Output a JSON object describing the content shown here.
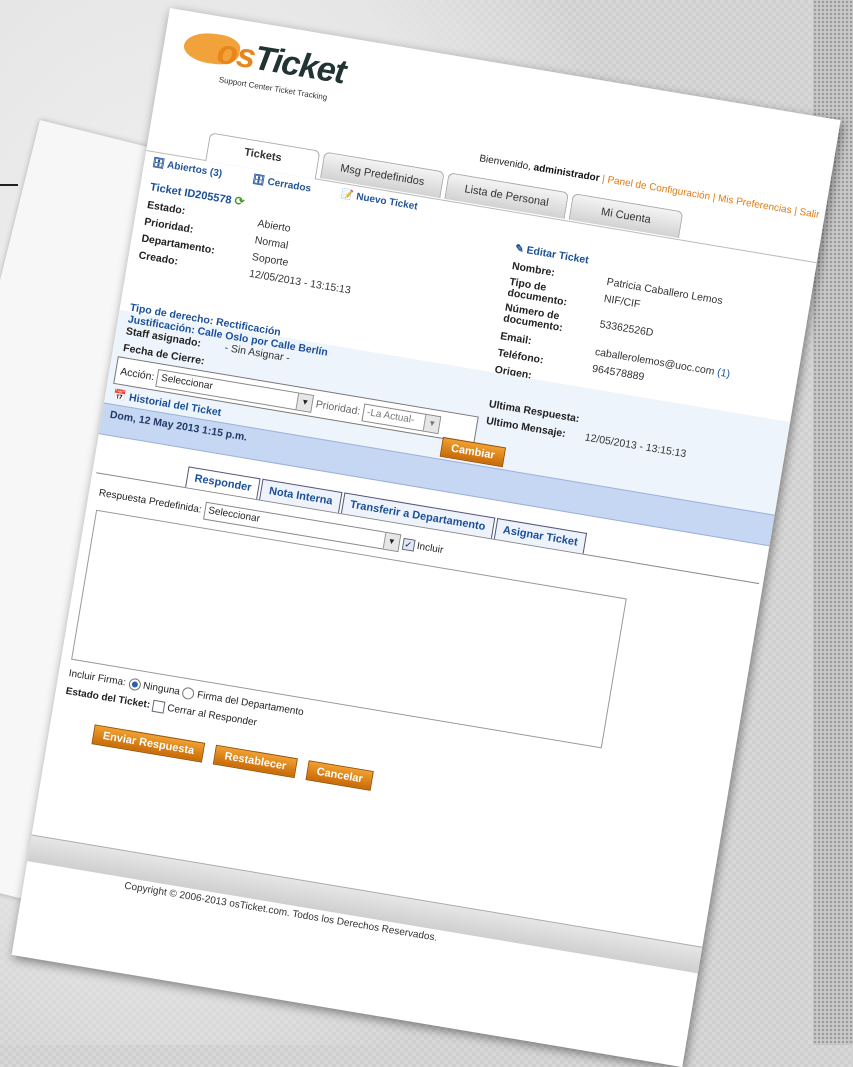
{
  "logo": {
    "text_os": "os",
    "text_ticket": "Ticket",
    "tagline": "Support Center Ticket Tracking"
  },
  "welcome": {
    "prefix": "Bienvenido, ",
    "user": "administrador",
    "links": " | Panel de Configuración | Mis Preferencias | Salir"
  },
  "tabs": [
    {
      "label": "Tickets"
    },
    {
      "label": "Msg Predefinidos"
    },
    {
      "label": "Lista de Personal"
    },
    {
      "label": "Mi Cuenta"
    }
  ],
  "subnav": {
    "open": "Abiertos (3)",
    "closed": "Cerrados",
    "new": "Nuevo Ticket"
  },
  "ticket": {
    "id": "Ticket ID205578",
    "estado_label": "Estado:",
    "estado": "Abierto",
    "prioridad_label": "Prioridad:",
    "prioridad": "Normal",
    "departamento_label": "Departamento:",
    "departamento": "Soporte",
    "creado_label": "Creado:",
    "creado": "12/05/2013 - 13:15:13"
  },
  "contact": {
    "edit": "Editar Ticket",
    "nombre_label": "Nombre:",
    "nombre": "Patricia Caballero Lemos",
    "tipo_doc_label": "Tipo de documento:",
    "tipo_doc": "NIF/CIF",
    "num_doc_label": "Número de documento:",
    "num_doc": "53362526D",
    "email_label": "Email:",
    "email": "caballerolemos@uoc.com",
    "email_count": "(1)",
    "telefono_label": "Teléfono:",
    "telefono": "964578889",
    "origen_label": "Origen:",
    "origen": ""
  },
  "rights": {
    "tipo_derecho": "Tipo de derecho: Rectificación",
    "justificacion": "Justificación: Calle Oslo por Calle Berlín",
    "staff_label": "Staff asignado:",
    "staff": "- Sin Asignar -",
    "cierre_label": "Fecha de Cierre:",
    "cierre": ""
  },
  "last": {
    "respuesta_label": "Ultima Respuesta:",
    "respuesta": "",
    "mensaje_label": "Ultimo Mensaje:",
    "mensaje": "12/05/2013 - 13:15:13"
  },
  "action": {
    "label": "Acción:",
    "select": "Seleccionar",
    "prioridad_label": "Prioridad:",
    "prioridad_select": "-La Actual-",
    "button": "Cambiar"
  },
  "history": {
    "title": "Historial del Ticket",
    "date": "Dom, 12 May 2013 1:15 p.m."
  },
  "reply": {
    "tabs": [
      {
        "label": "Responder"
      },
      {
        "label": "Nota Interna"
      },
      {
        "label": "Transferir a Departamento"
      },
      {
        "label": "Asignar Ticket"
      }
    ],
    "predef_label": "Respuesta Predefinida:",
    "predef_select": "Seleccionar",
    "incluir": "Incluir",
    "firma_label": "Incluir Firma:",
    "firma_none": "Ninguna",
    "firma_dept": "Firma del Departamento",
    "estado_label": "Estado del Ticket:",
    "cerrar": "Cerrar al Responder",
    "send": "Enviar Respuesta",
    "reset": "Restablecer",
    "cancel": "Cancelar"
  },
  "footer": "Copyright © 2006-2013 osTicket.com.  Todos los Derechos Reservados."
}
